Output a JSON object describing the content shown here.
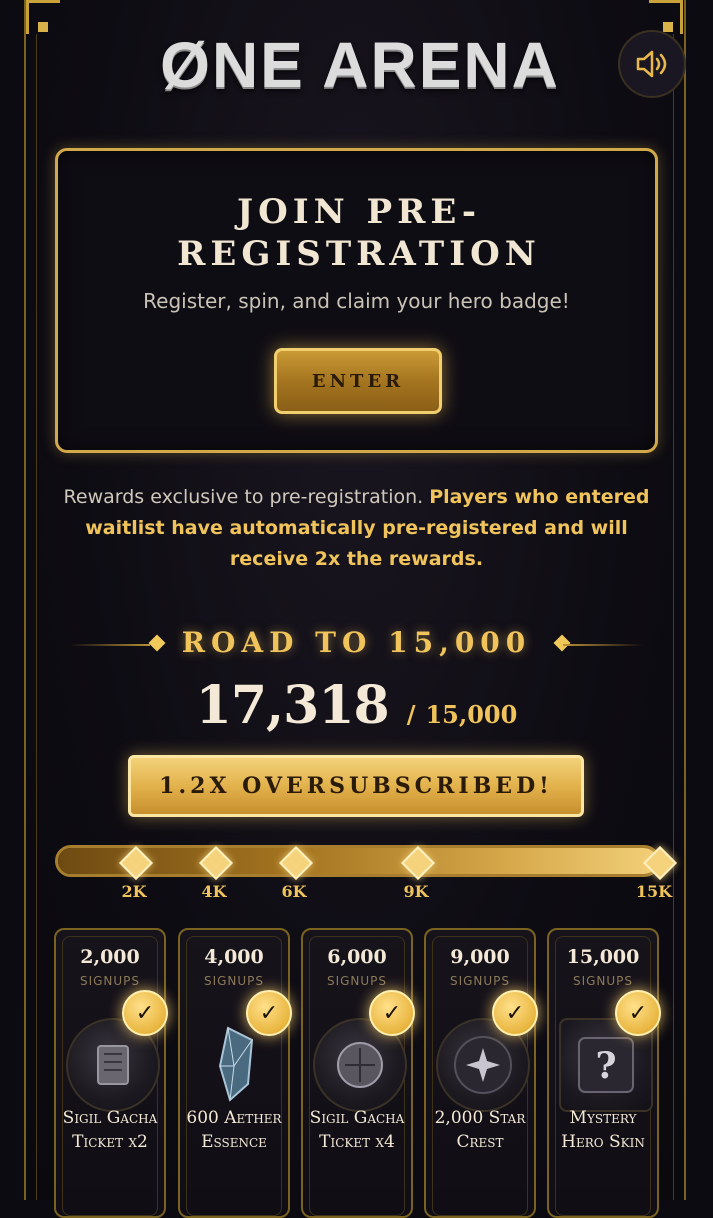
{
  "logo": {
    "text": "ØNE ARENA"
  },
  "registration": {
    "title": "JOIN PRE-REGISTRATION",
    "subtitle": "Register, spin, and claim your hero badge!",
    "enter_label": "ENTER"
  },
  "rewards_notice": {
    "normal": "Rewards exclusive to pre-registration. ",
    "highlight": "Players who entered waitlist have automatically pre-registered and will receive 2x the rewards."
  },
  "road": {
    "title": "ROAD TO 15,000",
    "current": "17,318",
    "separator": "/",
    "goal": "15,000",
    "oversubscribed_label": "1.2X OVERSUBSCRIBED!",
    "progress_fraction": 1.0
  },
  "milestones": [
    {
      "label": "2K"
    },
    {
      "label": "4K"
    },
    {
      "label": "6K"
    },
    {
      "label": "9K"
    },
    {
      "label": "15K"
    }
  ],
  "rewards": [
    {
      "count": "2,000",
      "unit": "SIGNUPS",
      "name": "Sigil Gacha Ticket x2",
      "icon": "gacha-ticket-icon",
      "check": "✓"
    },
    {
      "count": "4,000",
      "unit": "SIGNUPS",
      "name": "600 Aether Essence",
      "icon": "aether-crystal-icon",
      "check": "✓"
    },
    {
      "count": "6,000",
      "unit": "SIGNUPS",
      "name": "Sigil Gacha Ticket x4",
      "icon": "gacha-ticket-icon",
      "check": "✓"
    },
    {
      "count": "9,000",
      "unit": "SIGNUPS",
      "name": "2,000 Star Crest",
      "icon": "star-crest-icon",
      "check": "✓"
    },
    {
      "count": "15,000",
      "unit": "SIGNUPS",
      "name": "Mystery Hero Skin",
      "icon": "mystery-skin-icon",
      "check": "✓"
    }
  ],
  "colors": {
    "gold": "#f0c45a",
    "border_gold": "#d2a94a",
    "background": "#0d0b12"
  }
}
